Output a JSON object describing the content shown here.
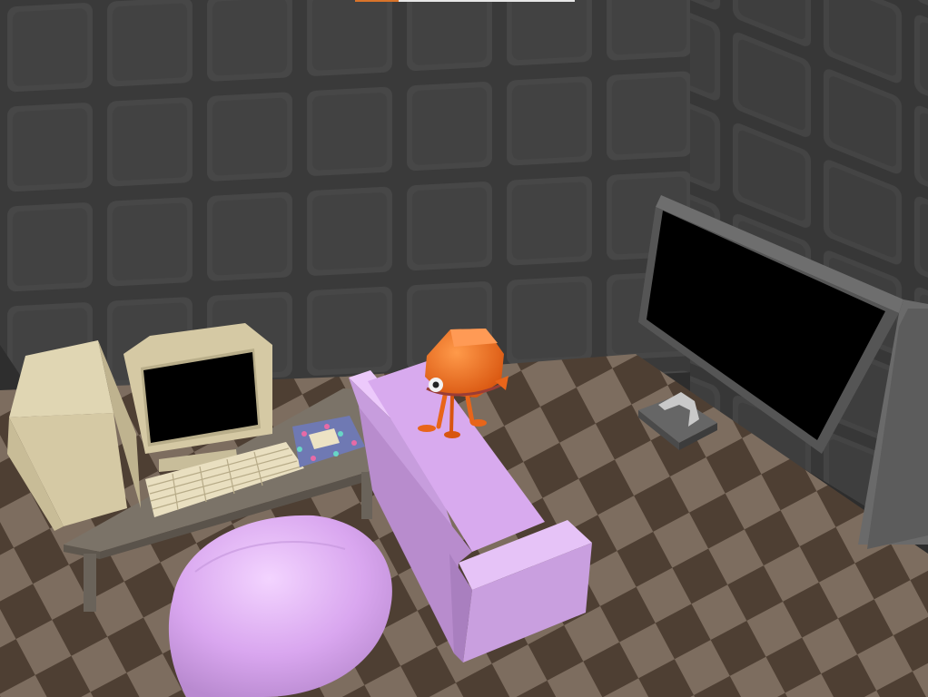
{
  "hud": {
    "progress_fraction": 0.2,
    "fill_color": "#d9742a",
    "track_color": "#e8e8e8"
  },
  "scene": {
    "objects": [
      "back-wall",
      "right-wall",
      "left-wall",
      "checkered-floor",
      "wall-tv",
      "game-console",
      "computer-tower",
      "crt-monitor",
      "keyboard",
      "mousepad",
      "desk",
      "couch",
      "beanbag",
      "player-character"
    ],
    "colors": {
      "wall": "#3f3f3f",
      "floor_dark": "#4e3f33",
      "floor_light": "#7d6d5f",
      "couch": "#d8aaee",
      "beanbag": "#d9a6ef",
      "character": "#e8651a",
      "computer": "#d5c9a4",
      "desk": "#7b7368",
      "tv_frame": "#5a5a5a",
      "tv_screen": "#000000"
    }
  }
}
